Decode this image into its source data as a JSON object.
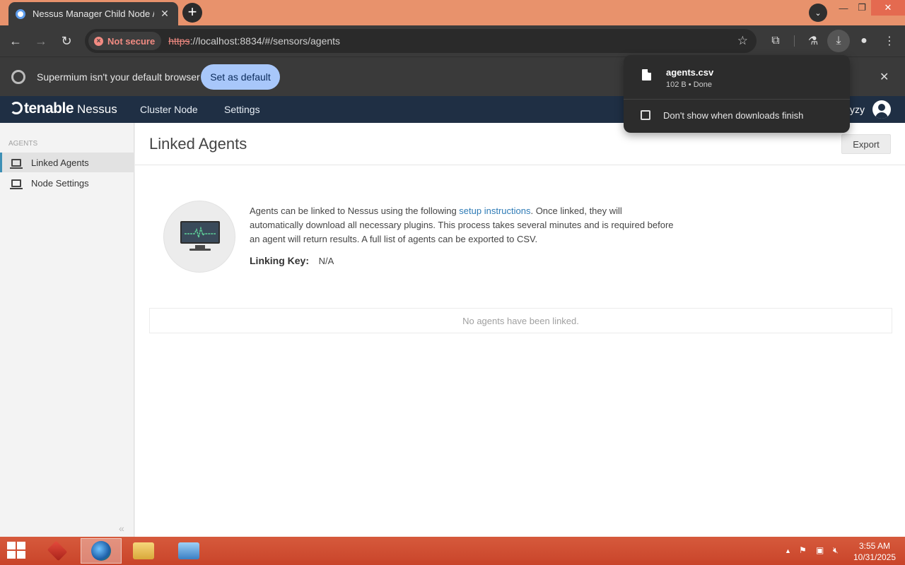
{
  "browser": {
    "tab_title": "Nessus Manager Child Node / L",
    "new_tab_symbol": "+",
    "url_scheme": "https",
    "url_rest": "://localhost:8834/#/sensors/agents",
    "security_label": "Not secure",
    "window_controls": [
      "—",
      "❐",
      "✕"
    ]
  },
  "infobar": {
    "message": "Supermium isn't your default browser",
    "button_label": "Set as default"
  },
  "app": {
    "brand_tenable": "tenable",
    "brand_nessus": "Nessus",
    "nav": [
      "Cluster Node",
      "Settings"
    ],
    "username": "yzy"
  },
  "sidebar": {
    "section": "AGENTS",
    "items": [
      {
        "label": "Linked Agents",
        "active": true
      },
      {
        "label": "Node Settings",
        "active": false
      }
    ]
  },
  "main": {
    "title": "Linked Agents",
    "export_label": "Export",
    "info_before_link": "Agents can be linked to Nessus using the following ",
    "info_link": "setup instructions",
    "info_after_link": ". Once linked, they will automatically download all necessary plugins. This process takes several minutes and is required before an agent will return results. A full list of agents can be exported to CSV.",
    "linking_key_label": "Linking Key:",
    "linking_key_value": "N/A",
    "empty_message": "No agents have been linked."
  },
  "download": {
    "file_name": "agents.csv",
    "status": "102 B • Done",
    "checkbox_label": "Don't show when downloads finish",
    "checked": false
  },
  "taskbar": {
    "time": "3:55 AM",
    "date": "10/31/2025"
  },
  "colors": {
    "title_bar": "#e8926c",
    "app_header": "#1f2f44",
    "link": "#2e7bb6",
    "taskbar": "#c9442a"
  }
}
